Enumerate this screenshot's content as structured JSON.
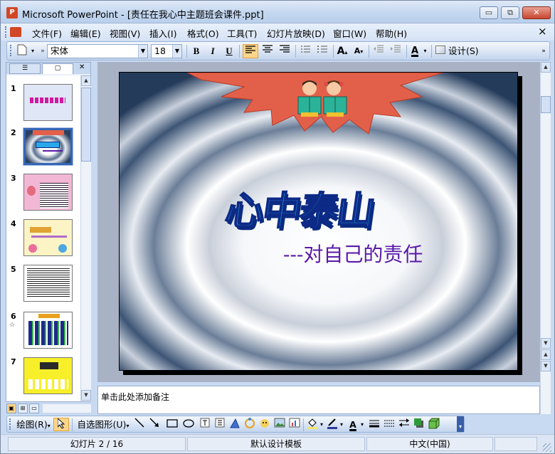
{
  "window": {
    "title": "Microsoft PowerPoint - [责任在我心中主题班会课件.ppt]",
    "app_icon_label": "P",
    "minimize_glyph": "▭",
    "restore_glyph": "⧉",
    "close_glyph": "✕"
  },
  "menu": {
    "items": [
      "文件(F)",
      "编辑(E)",
      "视图(V)",
      "插入(I)",
      "格式(O)",
      "工具(T)",
      "幻灯片放映(D)",
      "窗口(W)",
      "帮助(H)"
    ],
    "doc_close_glyph": "×"
  },
  "formatting": {
    "font_name": "宋体",
    "font_size": "18",
    "bold": "B",
    "italic": "I",
    "underline": "U",
    "font_color_label": "A",
    "grow_label": "A",
    "shrink_label": "A",
    "design_label": "设计(S)"
  },
  "outline_panel": {
    "tab_outline_glyph": "☰",
    "tab_slides_glyph": "▢",
    "close_glyph": "✕",
    "slides": [
      {
        "number": "1",
        "star": ""
      },
      {
        "number": "2",
        "star": ""
      },
      {
        "number": "3",
        "star": ""
      },
      {
        "number": "4",
        "star": ""
      },
      {
        "number": "5",
        "star": ""
      },
      {
        "number": "6",
        "star": "☆"
      },
      {
        "number": "7",
        "star": ""
      }
    ],
    "selected_index": 2
  },
  "slide": {
    "title": "心中泰山",
    "subtitle": "---对自己的责任"
  },
  "notes": {
    "placeholder": "单击此处添加备注"
  },
  "drawing": {
    "draw_menu": "绘图(R)",
    "autoshapes_menu": "自选图形(U)"
  },
  "status": {
    "slide_pos": "幻灯片 2 / 16",
    "template": "默认设计模板",
    "language": "中文(中国)"
  },
  "colors": {
    "title_fill": "#29a8e8",
    "title_outline": "#0c2a86",
    "subtitle": "#5a1aa8",
    "starburst": "#e2604a",
    "selection": "#3566b5"
  }
}
